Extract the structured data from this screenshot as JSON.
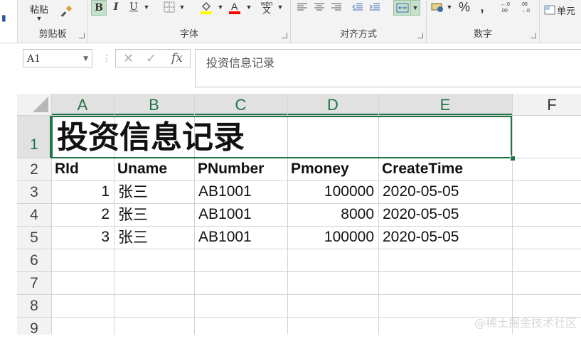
{
  "ribbon": {
    "clipboard": {
      "paste_label": "粘贴",
      "group_label": "剪贴板"
    },
    "font": {
      "bold": "B",
      "italic": "I",
      "underline": "U",
      "group_label": "字体",
      "phonetic": "wén"
    },
    "alignment": {
      "group_label": "对齐方式"
    },
    "number": {
      "group_label": "数字",
      "percent": "%",
      "comma": ","
    },
    "styles": {
      "cell_styles_label": "单元"
    }
  },
  "formula_bar": {
    "name_box": "A1",
    "cancel": "✕",
    "enter": "✓",
    "fx": "fx",
    "content": "投资信息记录"
  },
  "sheet": {
    "columns": [
      "A",
      "B",
      "C",
      "D",
      "E",
      "F"
    ],
    "rows": [
      "1",
      "2",
      "3",
      "4",
      "5",
      "6",
      "7",
      "8",
      "9"
    ],
    "title": "投资信息记录",
    "headers": [
      "RId",
      "Uname",
      "PNumber",
      "Pmoney",
      "CreateTime"
    ],
    "records": [
      {
        "rid": "1",
        "uname": "张三",
        "pnumber": "AB1001",
        "pmoney": "100000",
        "createtime": "2020-05-05"
      },
      {
        "rid": "2",
        "uname": "张三",
        "pnumber": "AB1001",
        "pmoney": "8000",
        "createtime": "2020-05-05"
      },
      {
        "rid": "3",
        "uname": "张三",
        "pnumber": "AB1001",
        "pmoney": "100000",
        "createtime": "2020-05-05"
      }
    ]
  },
  "watermark": "@稀土掘金技术社区",
  "colors": {
    "accent": "#217346",
    "selected_header_bg": "#e1e1e1"
  }
}
